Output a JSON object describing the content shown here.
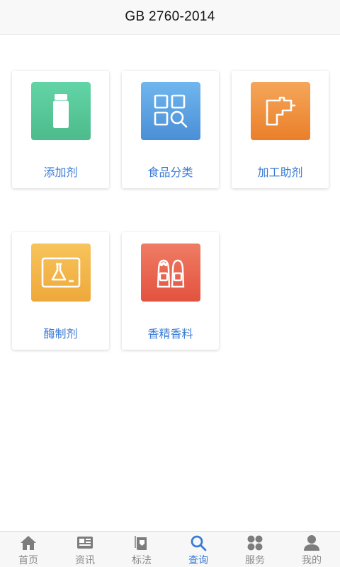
{
  "header": {
    "title": "GB 2760-2014"
  },
  "cards": [
    {
      "label": "添加剂",
      "icon": "bottle-icon",
      "color_top": "#63d4a6",
      "color_bottom": "#4dbb8c"
    },
    {
      "label": "食品分类",
      "icon": "category-search-icon",
      "color_top": "#70b6ee",
      "color_bottom": "#4a8fd6"
    },
    {
      "label": "加工助剂",
      "icon": "processing-pipe-icon",
      "color_top": "#f5a65a",
      "color_bottom": "#ea7f2a"
    },
    {
      "label": "酶制剂",
      "icon": "lab-flask-icon",
      "color_top": "#f7c45c",
      "color_bottom": "#eea83a"
    },
    {
      "label": "香精香料",
      "icon": "salt-pepper-shakers-icon",
      "color_top": "#f07c64",
      "color_bottom": "#e2523f"
    }
  ],
  "tabs": [
    {
      "label": "首页",
      "icon": "home-icon",
      "active": false
    },
    {
      "label": "资讯",
      "icon": "news-icon",
      "active": false
    },
    {
      "label": "标法",
      "icon": "standards-book-icon",
      "active": false
    },
    {
      "label": "查询",
      "icon": "search-icon",
      "active": true
    },
    {
      "label": "服务",
      "icon": "services-grid-icon",
      "active": false
    },
    {
      "label": "我的",
      "icon": "profile-icon",
      "active": false
    }
  ],
  "colors": {
    "accent": "#3a7bd5",
    "inactive": "#8a8a8a"
  }
}
